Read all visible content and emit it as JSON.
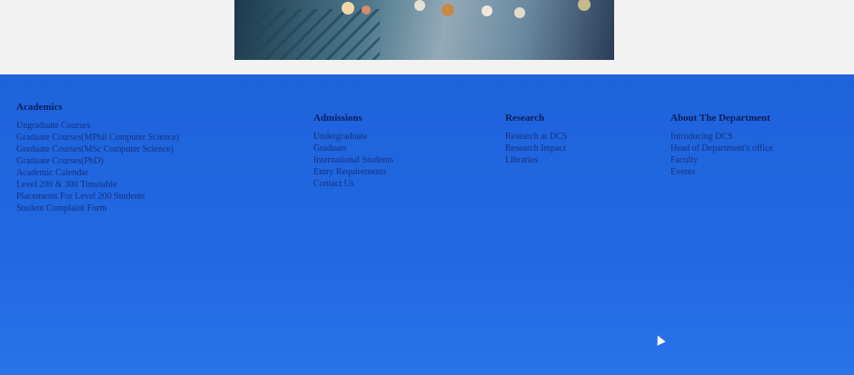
{
  "footer": {
    "academics": {
      "heading": "Academics",
      "links": [
        "Ungraduate Courses",
        "Graduate Courses(MPhil Computer Science)",
        "Graduate Courses(MSc Computer Science)",
        "Graduate Courses(PhD)",
        "Academic Calendar",
        "Level 200 & 300 Timetable",
        "Placements For Level 200 Students",
        "Student Complaint Form"
      ]
    },
    "admissions": {
      "heading": "Admissions",
      "links": [
        "Undergraduate",
        "Graduate",
        "International Students",
        "Entry Requirements",
        "Contact Us"
      ]
    },
    "research": {
      "heading": "Research",
      "links": [
        "Research at DCS",
        "Research Impact",
        "Libraries"
      ]
    },
    "about": {
      "heading": "About The Department",
      "links": [
        "Introducing DCS",
        "Head of Department's office",
        "Faculty",
        "Events"
      ]
    }
  },
  "colors": {
    "footer_background": "#1e63dc",
    "heading": "#0d1d57",
    "link": "#16307c"
  }
}
